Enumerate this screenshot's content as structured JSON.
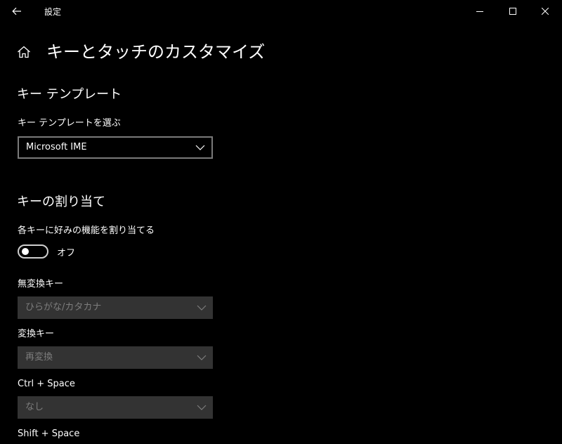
{
  "titlebar": {
    "app_name": "設定"
  },
  "header": {
    "title": "キーとタッチのカスタマイズ"
  },
  "key_template": {
    "section_title": "キー テンプレート",
    "label": "キー テンプレートを選ぶ",
    "selected": "Microsoft IME"
  },
  "key_assign": {
    "section_title": "キーの割り当て",
    "toggle_label": "各キーに好みの機能を割り当てる",
    "toggle_state": "オフ",
    "toggle_on": false,
    "fields": [
      {
        "label": "無変換キー",
        "value": "ひらがな/カタカナ",
        "enabled": false
      },
      {
        "label": "変換キー",
        "value": "再変換",
        "enabled": false
      },
      {
        "label": "Ctrl + Space",
        "value": "なし",
        "enabled": false
      },
      {
        "label": "Shift + Space"
      }
    ]
  },
  "icons": {
    "back": "back-arrow-icon",
    "home": "home-icon",
    "minimize": "minimize-icon",
    "maximize": "maximize-icon",
    "close": "close-icon",
    "dropdown": "chevron-down-icon"
  },
  "colors": {
    "background": "#000000",
    "text": "#ffffff",
    "disabled_bg": "#333333",
    "disabled_text": "#7d7d7d",
    "border": "#7a7a7a"
  }
}
